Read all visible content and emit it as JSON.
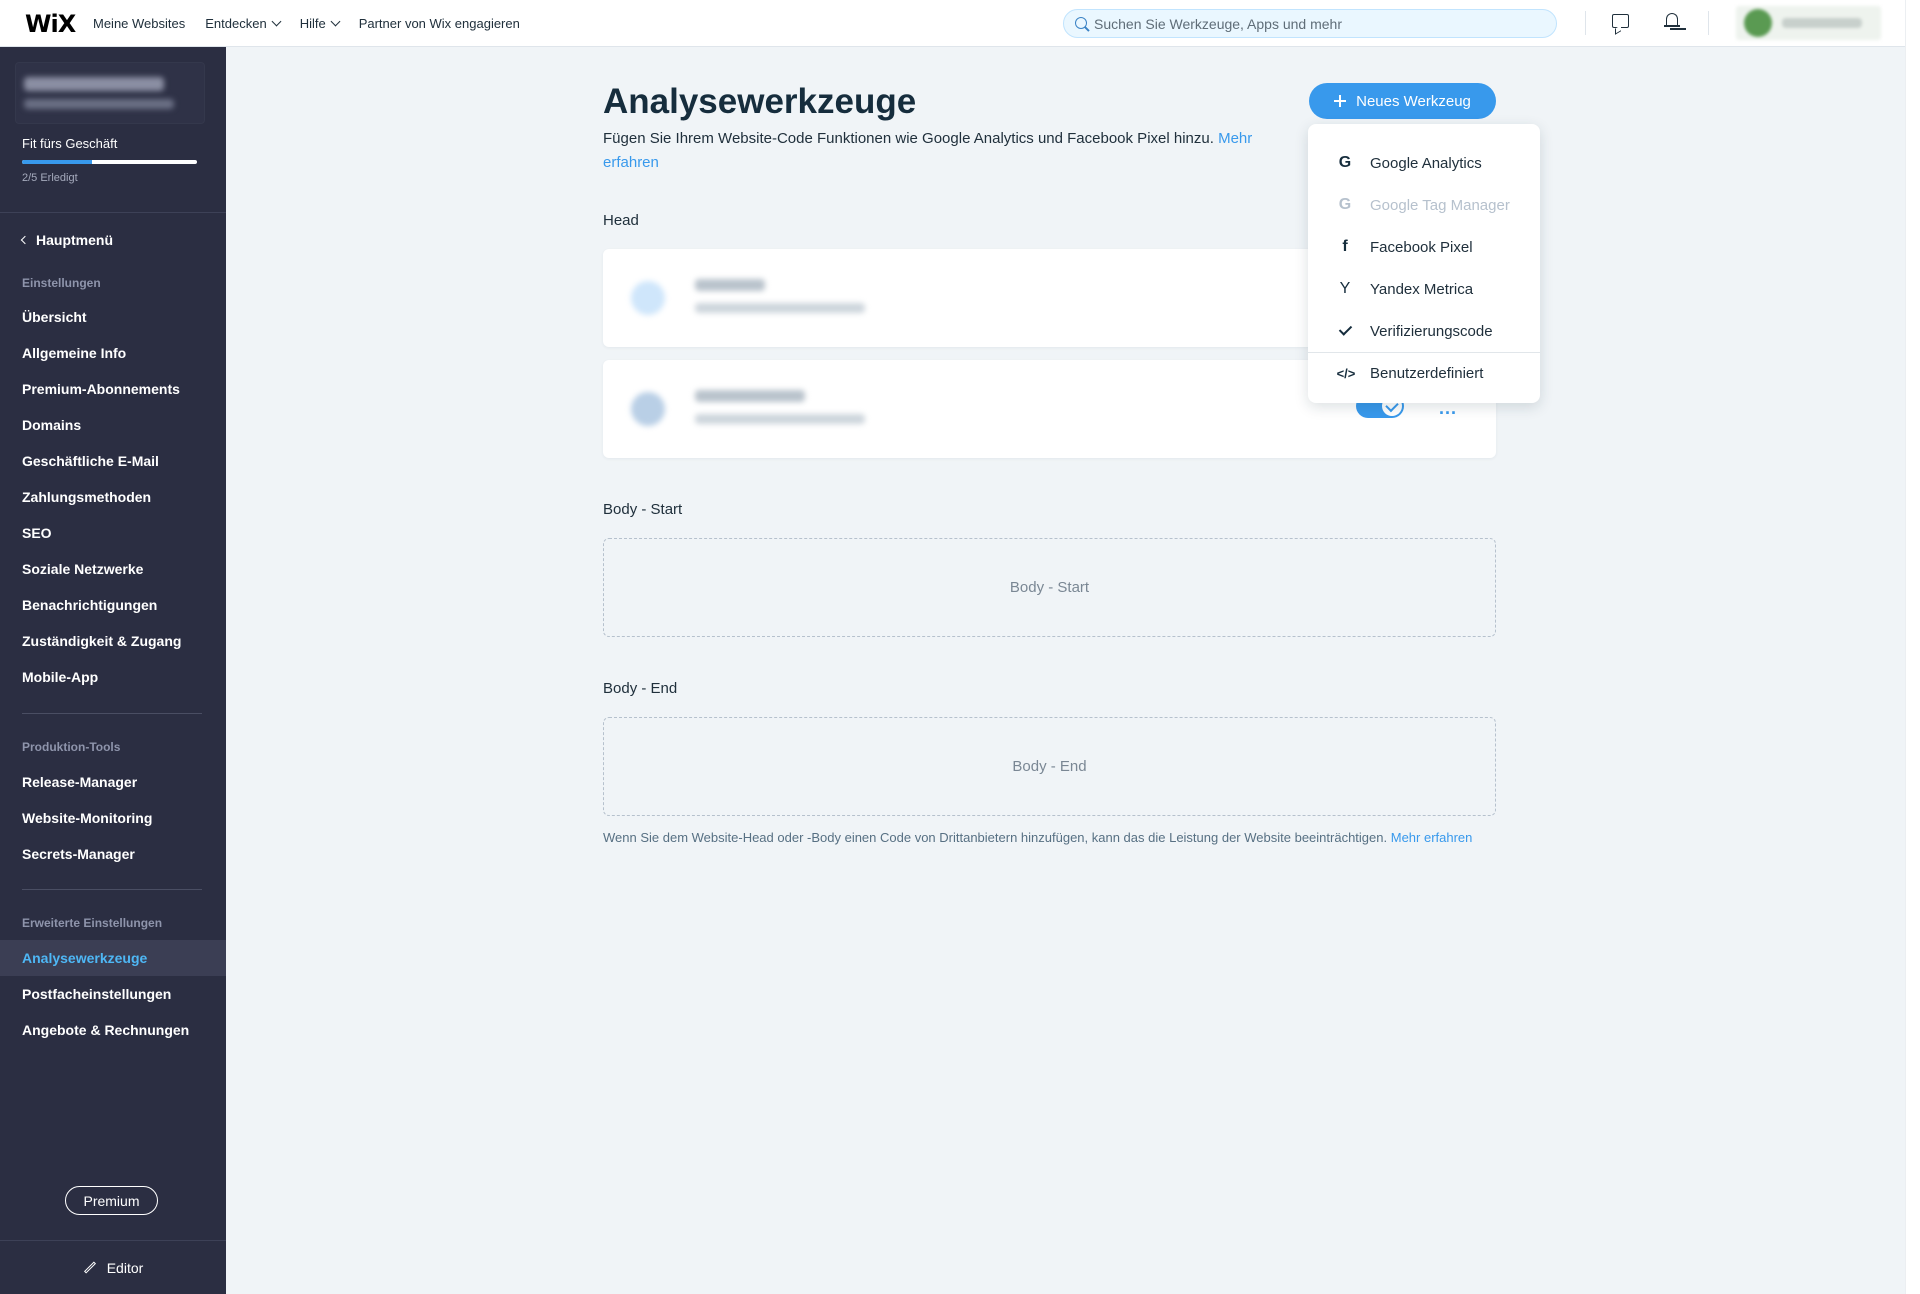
{
  "topbar": {
    "logo": "WiX",
    "nav": [
      "Meine Websites",
      "Entdecken",
      "Hilfe",
      "Partner von Wix engagieren"
    ],
    "search_placeholder": "Suchen Sie Werkzeuge, Apps und mehr"
  },
  "sidebar": {
    "fit_label": "Fit fürs Geschäft",
    "progress_text": "2/5 Erledigt",
    "progress_fraction": 0.4,
    "back_label": "Hauptmenü",
    "section_settings": "Einstellungen",
    "settings_items": [
      "Übersicht",
      "Allgemeine Info",
      "Premium-Abonnements",
      "Domains",
      "Geschäftliche E-Mail",
      "Zahlungsmethoden",
      "SEO",
      "Soziale Netzwerke",
      "Benachrichtigungen",
      "Zuständigkeit & Zugang",
      "Mobile-App"
    ],
    "section_production": "Produktion-Tools",
    "production_items": [
      "Release-Manager",
      "Website-Monitoring",
      "Secrets-Manager"
    ],
    "section_advanced": "Erweiterte Einstellungen",
    "advanced_items": [
      "Analysewerkzeuge",
      "Postfacheinstellungen",
      "Angebote & Rechnungen"
    ],
    "active_item": "Analysewerkzeuge",
    "premium_label": "Premium",
    "editor_label": "Editor"
  },
  "main": {
    "title": "Analysewerkzeuge",
    "description": "Fügen Sie Ihrem Website-Code Funktionen wie Google Analytics und Facebook Pixel hinzu.",
    "description_link": "Mehr erfahren",
    "new_tool_label": "Neues Werkzeug",
    "head_label": "Head",
    "body_start_label": "Body - Start",
    "body_start_zone": "Body - Start",
    "body_end_label": "Body - End",
    "body_end_zone": "Body - End",
    "footnote": "Wenn Sie dem Website-Head oder -Body einen Code von Drittanbietern hinzufügen, kann das die Leistung der Website beeinträchtigen.",
    "footnote_link": "Mehr erfahren",
    "more_label": "..."
  },
  "dropdown": {
    "items": [
      {
        "label": "Google Analytics",
        "icon": "google-icon",
        "glyph": "G",
        "disabled": false
      },
      {
        "label": "Google Tag Manager",
        "icon": "google-icon",
        "glyph": "G",
        "disabled": true
      },
      {
        "label": "Facebook Pixel",
        "icon": "facebook-icon",
        "glyph": "f",
        "disabled": false
      },
      {
        "label": "Yandex Metrica",
        "icon": "yandex-icon",
        "glyph": "Y",
        "disabled": false
      },
      {
        "label": "Verifizierungscode",
        "icon": "check-icon",
        "glyph": "",
        "disabled": false
      },
      {
        "label": "Benutzerdefiniert",
        "icon": "code-icon",
        "glyph": "</>",
        "disabled": false
      }
    ]
  },
  "colors": {
    "accent": "#3899ec",
    "sidebar_bg": "#2b2e42",
    "main_bg": "#f0f4f7"
  }
}
